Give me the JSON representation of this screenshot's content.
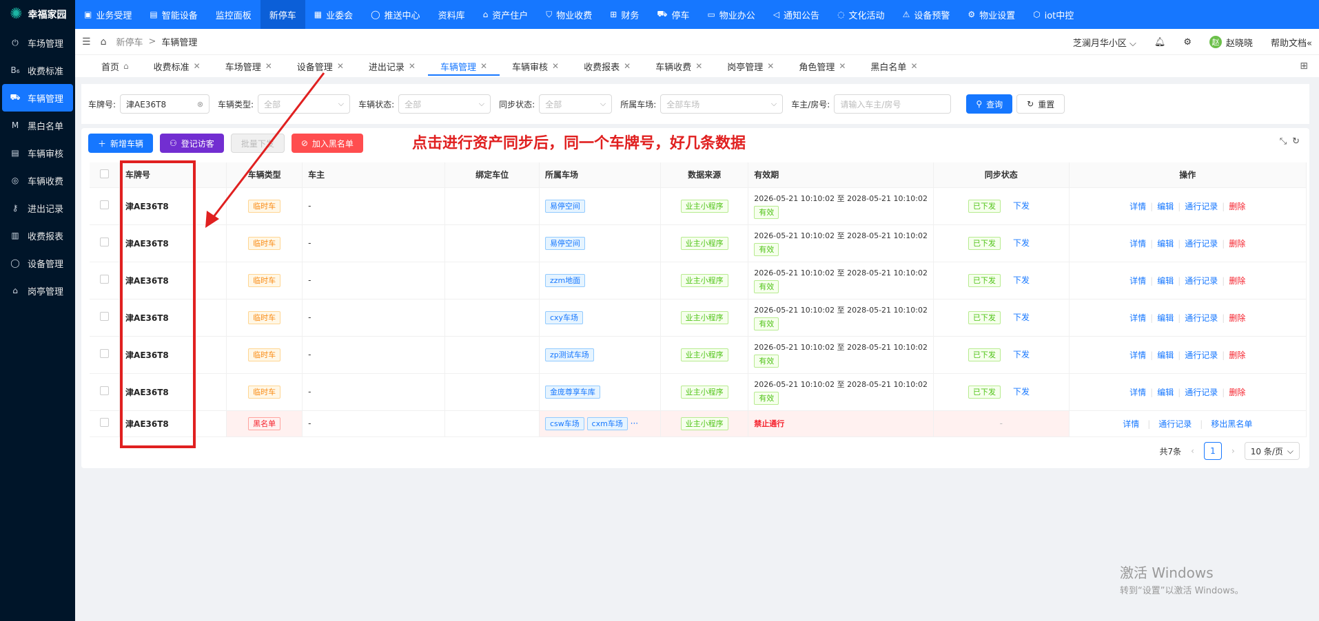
{
  "app": {
    "name": "幸福家园"
  },
  "sidebar": {
    "items": [
      {
        "label": "车场管理",
        "icon": "plug-icon"
      },
      {
        "label": "收费标准",
        "icon": "bo-icon"
      },
      {
        "label": "车辆管理",
        "icon": "car-icon",
        "active": true
      },
      {
        "label": "黑白名单",
        "icon": "m-icon"
      },
      {
        "label": "车辆审核",
        "icon": "audit-icon"
      },
      {
        "label": "车辆收费",
        "icon": "coin-icon"
      },
      {
        "label": "进出记录",
        "icon": "key-icon"
      },
      {
        "label": "收费报表",
        "icon": "report-icon"
      },
      {
        "label": "设备管理",
        "icon": "device-icon"
      },
      {
        "label": "岗亭管理",
        "icon": "booth-icon"
      }
    ]
  },
  "topnav": {
    "items": [
      {
        "label": "业务受理",
        "icon": "▣"
      },
      {
        "label": "智能设备",
        "icon": "▤"
      },
      {
        "label": "监控面板",
        "icon": ""
      },
      {
        "label": "新停车",
        "icon": "",
        "active": true
      },
      {
        "label": "业委会",
        "icon": "▦"
      },
      {
        "label": "推送中心",
        "icon": "◯"
      },
      {
        "label": "资料库",
        "icon": ""
      },
      {
        "label": "资产住户",
        "icon": "⌂"
      },
      {
        "label": "物业收费",
        "icon": "⛉"
      },
      {
        "label": "财务",
        "icon": "⊞"
      },
      {
        "label": "停车",
        "icon": "⛟"
      },
      {
        "label": "物业办公",
        "icon": "▭"
      },
      {
        "label": "通知公告",
        "icon": "◁"
      },
      {
        "label": "文化活动",
        "icon": "◌"
      },
      {
        "label": "设备预警",
        "icon": "⚠"
      },
      {
        "label": "物业设置",
        "icon": "⚙"
      },
      {
        "label": "iot中控",
        "icon": "⬡"
      }
    ]
  },
  "header": {
    "breadcrumb": {
      "parent": "新停车",
      "sep": ">",
      "current": "车辆管理"
    },
    "community": "芝澜月华小区",
    "user_initial": "赵",
    "user_name": "赵晓晓",
    "help": "帮助文档"
  },
  "tabs": [
    {
      "label": "首页",
      "home": true
    },
    {
      "label": "收费标准"
    },
    {
      "label": "车场管理"
    },
    {
      "label": "设备管理"
    },
    {
      "label": "进出记录"
    },
    {
      "label": "车辆管理",
      "active": true
    },
    {
      "label": "车辆审核"
    },
    {
      "label": "收费报表"
    },
    {
      "label": "车辆收费"
    },
    {
      "label": "岗亭管理"
    },
    {
      "label": "角色管理"
    },
    {
      "label": "黑白名单"
    }
  ],
  "filters": {
    "plate_label": "车牌号:",
    "plate_value": "津AE36T8",
    "type_label": "车辆类型:",
    "type_placeholder": "全部",
    "status_label": "车辆状态:",
    "status_placeholder": "全部",
    "sync_label": "同步状态:",
    "sync_placeholder": "全部",
    "lot_label": "所属车场:",
    "lot_placeholder": "全部车场",
    "owner_label": "车主/房号:",
    "owner_placeholder": "请输入车主/房号",
    "query": "查询",
    "reset": "重置"
  },
  "toolbar": {
    "add": "新增车辆",
    "visitor": "登记访客",
    "batch": "批量下发",
    "blacklist": "加入黑名单"
  },
  "annotation": "点击进行资产同步后，同一个车牌号，好几条数据",
  "table": {
    "headers": [
      "车牌号",
      "车辆类型",
      "车主",
      "绑定车位",
      "所属车场",
      "数据来源",
      "有效期",
      "同步状态",
      "操作"
    ],
    "rows": [
      {
        "plate": "津AE36T8",
        "type": "临时车",
        "owner": "-",
        "lot": "易停空间",
        "source": "业主小程序",
        "validity": "2026-05-21 10:10:02 至 2028-05-21 10:10:02",
        "valid_tag": "有效",
        "sync": "已下发",
        "sync_action": "下发",
        "ops": [
          "详情",
          "编辑",
          "通行记录",
          "删除"
        ]
      },
      {
        "plate": "津AE36T8",
        "type": "临时车",
        "owner": "-",
        "lot": "易停空间",
        "source": "业主小程序",
        "validity": "2026-05-21 10:10:02 至 2028-05-21 10:10:02",
        "valid_tag": "有效",
        "sync": "已下发",
        "sync_action": "下发",
        "ops": [
          "详情",
          "编辑",
          "通行记录",
          "删除"
        ]
      },
      {
        "plate": "津AE36T8",
        "type": "临时车",
        "owner": "-",
        "lot": "zzm地面",
        "source": "业主小程序",
        "validity": "2026-05-21 10:10:02 至 2028-05-21 10:10:02",
        "valid_tag": "有效",
        "sync": "已下发",
        "sync_action": "下发",
        "ops": [
          "详情",
          "编辑",
          "通行记录",
          "删除"
        ]
      },
      {
        "plate": "津AE36T8",
        "type": "临时车",
        "owner": "-",
        "lot": "cxy车场",
        "source": "业主小程序",
        "validity": "2026-05-21 10:10:02 至 2028-05-21 10:10:02",
        "valid_tag": "有效",
        "sync": "已下发",
        "sync_action": "下发",
        "ops": [
          "详情",
          "编辑",
          "通行记录",
          "删除"
        ]
      },
      {
        "plate": "津AE36T8",
        "type": "临时车",
        "owner": "-",
        "lot": "zp测试车场",
        "source": "业主小程序",
        "validity": "2026-05-21 10:10:02 至 2028-05-21 10:10:02",
        "valid_tag": "有效",
        "sync": "已下发",
        "sync_action": "下发",
        "ops": [
          "详情",
          "编辑",
          "通行记录",
          "删除"
        ]
      },
      {
        "plate": "津AE36T8",
        "type": "临时车",
        "owner": "-",
        "lot": "金庞尊享车库",
        "source": "业主小程序",
        "validity": "2026-05-21 10:10:02 至 2028-05-21 10:10:02",
        "valid_tag": "有效",
        "sync": "已下发",
        "sync_action": "下发",
        "ops": [
          "详情",
          "编辑",
          "通行记录",
          "删除"
        ]
      }
    ],
    "black_row": {
      "plate": "津AE36T8",
      "type": "黑名单",
      "owner": "-",
      "lot1": "csw车场",
      "lot2": "cxm车场",
      "more": "···",
      "source": "业主小程序",
      "validity": "禁止通行",
      "sync": "-",
      "ops": [
        "详情",
        "通行记录",
        "移出黑名单"
      ]
    }
  },
  "pager": {
    "total": "共7条",
    "page": "1",
    "size": "10 条/页"
  },
  "windows": {
    "line1": "激活 Windows",
    "line2": "转到“设置”以激活 Windows。"
  }
}
